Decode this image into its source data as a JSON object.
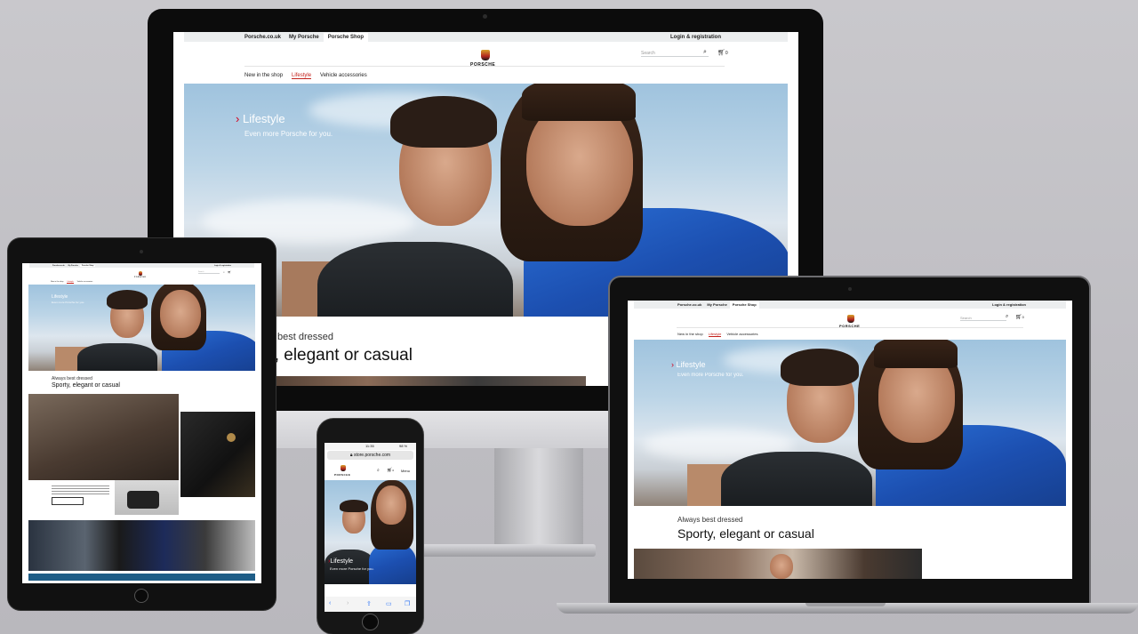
{
  "site": {
    "top_links": [
      "Porsche.co.uk",
      "My Porsche",
      "Porsche Shop"
    ],
    "login": "Login & registration",
    "logo_word": "PORSCHE",
    "search_placeholder": "Search",
    "search_icon": "search-icon",
    "cart_icon": "cart-icon",
    "cart_count": "0",
    "nav": [
      "New in the shop",
      "Lifestyle",
      "Vehicle accessories"
    ],
    "hero_title": "Lifestyle",
    "hero_sub": "Even more Porsche for you.",
    "kicker": "Always best dressed",
    "headline": "Sporty, elegant or casual",
    "monitor_kicker": "best dressed",
    "monitor_headline": "rty, elegant or casual"
  },
  "phone": {
    "time": "11:35",
    "battery": "98 %",
    "url": "store.porsche.com",
    "menu": "Menu",
    "cart_count": "0"
  },
  "colors": {
    "accent": "#d5001c",
    "jacket_blue": "#2a6fd6",
    "device_black": "#0c0c0c"
  }
}
